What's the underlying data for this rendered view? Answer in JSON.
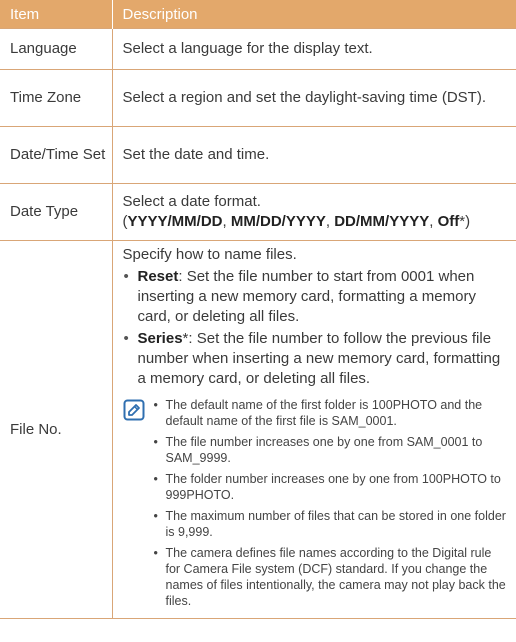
{
  "header": {
    "item": "Item",
    "description": "Description"
  },
  "rows": {
    "language": {
      "item": "Language",
      "desc": "Select a language for the display text."
    },
    "time_zone": {
      "item": "Time Zone",
      "desc": "Select a region and set the daylight-saving time (DST)."
    },
    "date_time_set": {
      "item": "Date/Time Set",
      "desc": "Set the date and time."
    },
    "date_type": {
      "item": "Date Type",
      "desc": "Select a date format.",
      "open": "(",
      "opt1": "YYYY/MM/DD",
      "sep": ", ",
      "opt2": "MM/DD/YYYY",
      "opt3": "DD/MM/YYYY",
      "opt4": "Off",
      "close": "*)"
    },
    "file_no": {
      "item": "File No.",
      "intro": "Specify how to name files.",
      "reset_label": "Reset",
      "reset_text": ": Set the file number to start from 0001 when inserting a new memory card, formatting a memory card, or deleting all files.",
      "series_label": "Series",
      "series_text": "*: Set the file number to follow the previous file number when inserting a new memory card, formatting a memory card, or deleting all files.",
      "notes": [
        "The default name of the first folder is 100PHOTO and the default name of the first file is SAM_0001.",
        "The file number increases one by one from SAM_0001 to SAM_9999.",
        "The folder number increases one by one from 100PHOTO to 999PHOTO.",
        "The maximum number of files that can be stored in one folder is 9,999.",
        "The camera defines file names according to the Digital rule for Camera File system (DCF) standard. If you change the names of files intentionally, the camera may not play back the files."
      ]
    }
  },
  "colors": {
    "header_bg": "#e3a86b",
    "border": "#d9a677",
    "note_icon": "#2f6fb0"
  }
}
